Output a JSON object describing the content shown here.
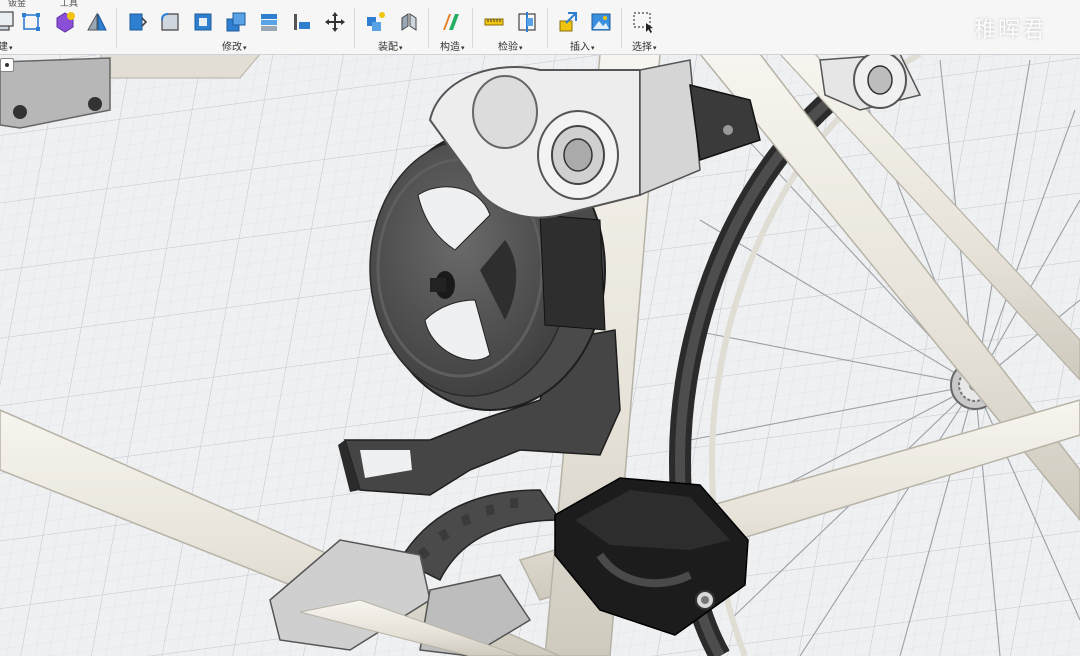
{
  "toolbar": {
    "tabs": [
      "钣金",
      "工具"
    ],
    "groups": [
      {
        "id": "modify",
        "label": "修改"
      },
      {
        "id": "assemble",
        "label": "装配"
      },
      {
        "id": "construct",
        "label": "构造"
      },
      {
        "id": "inspect",
        "label": "检验"
      },
      {
        "id": "insert",
        "label": "插入"
      },
      {
        "id": "select",
        "label": "选择"
      }
    ],
    "caret": "▾",
    "left_edge_label": "建"
  },
  "watermark": {
    "text": "稚晖君"
  },
  "colors": {
    "toolbar_bg": "#f6f6f6",
    "accent_blue": "#2f7fd1",
    "grid_bg": "#eceef0",
    "frame_white": "#e9e6dd",
    "part_dark": "#3a3a3a",
    "part_metal": "#b8b8b8"
  },
  "icons": [
    "extrude-icon",
    "sketch-icon",
    "component-icon",
    "mirror-icon",
    "press-pull-icon",
    "fillet-icon",
    "shell-icon",
    "combine-icon",
    "align-icon",
    "move-icon",
    "new-component-icon",
    "joint-icon",
    "offset-plane-icon",
    "measure-icon",
    "section-analysis-icon",
    "insert-derive-icon",
    "insert-image-icon",
    "select-window-icon"
  ]
}
